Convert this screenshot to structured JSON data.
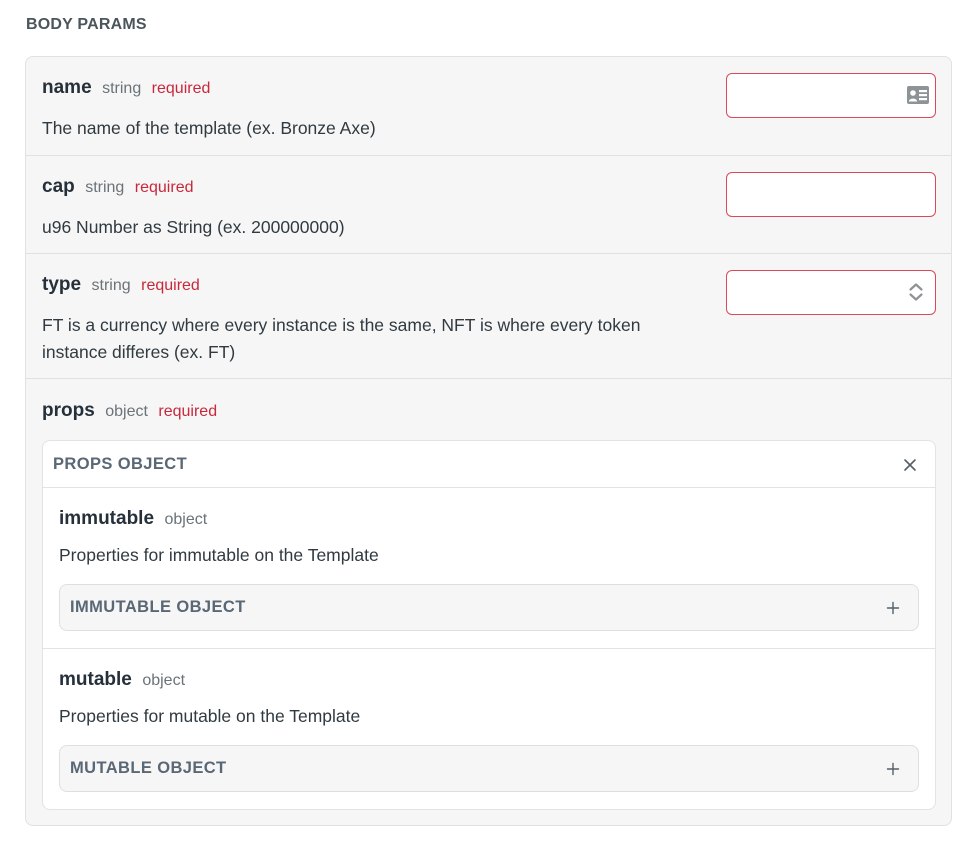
{
  "section": {
    "title": "BODY PARAMS"
  },
  "params": [
    {
      "name": "name",
      "type": "string",
      "required": "required",
      "description": "The name of the template (ex. Bronze Axe)",
      "input_value": "",
      "input_icon": "contact-card-icon"
    },
    {
      "name": "cap",
      "type": "string",
      "required": "required",
      "description": "u96 Number as String (ex. 200000000)",
      "input_value": ""
    },
    {
      "name": "type",
      "type": "string",
      "required": "required",
      "description": "FT is a currency where every instance is the same, NFT is where every token instance differes (ex. FT)",
      "selected_value": "",
      "input_icon": "select-arrows-icon"
    }
  ],
  "props": {
    "name": "props",
    "type": "object",
    "required": "required",
    "object_title": "PROPS OBJECT",
    "close_icon": "close-icon",
    "children": [
      {
        "name": "immutable",
        "type": "object",
        "description": "Properties for immutable on the Template",
        "object_title": "IMMUTABLE OBJECT",
        "expand_icon": "plus-icon"
      },
      {
        "name": "mutable",
        "type": "object",
        "description": "Properties for mutable on the Template",
        "object_title": "MUTABLE OBJECT",
        "expand_icon": "plus-icon"
      }
    ]
  },
  "colors": {
    "required": "#c8283c",
    "input_border": "#d9485d",
    "panel_bg": "#f6f6f6",
    "object_title": "#5a6775"
  }
}
